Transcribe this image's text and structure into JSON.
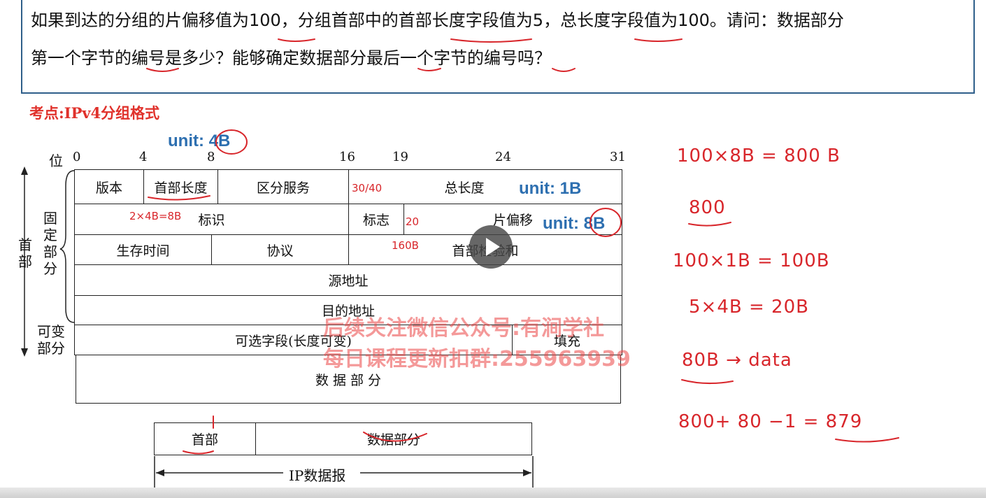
{
  "question": {
    "line1": "如果到达的分组的片偏移值为100，分组首部中的首部长度字段值为5，总长度字段值为100。请问：数据部分",
    "line2": "第一个字节的编号是多少？能够确定数据部分最后一个字节的编号吗？"
  },
  "topic": "考点:IPv4分组格式",
  "units": {
    "u4": "unit: 4B",
    "u1": "unit: 1B",
    "u8": "unit: 8B"
  },
  "bits": {
    "label": "位",
    "b0": "0",
    "b4": "4",
    "b8": "8",
    "b16": "16",
    "b19": "19",
    "b24": "24",
    "b31": "31"
  },
  "side": {
    "header": "首部",
    "fixed": "固定部分",
    "variable": "可变部分"
  },
  "fields": {
    "version": "版本",
    "ihl": "首部长度",
    "tos": "区分服务",
    "total_length": "总长度",
    "identification": "标识",
    "flags": "标志",
    "fragment_offset": "片偏移",
    "ttl": "生存时间",
    "protocol": "协议",
    "checksum": "首部检验和",
    "src": "源地址",
    "dst": "目的地址",
    "options": "可选字段(长度可变)",
    "padding": "填充",
    "data": "数 据 部 分"
  },
  "datagram": {
    "header": "首部",
    "data": "数据部分",
    "label": "IP数据报"
  },
  "annotations": {
    "a1": "30/40",
    "a2": "2×4B=8B",
    "a3": "20",
    "a4": "160B",
    "calc1": "100×8B = 800 B",
    "calc2": "800",
    "calc3": "100×1B = 100B",
    "calc4": "5×4B = 20B",
    "calc5": "80B → data",
    "calc6": "800+ 80 −1 = 879"
  },
  "watermark": {
    "line1": "后续关注微信公众号:有涧学社",
    "line2": "每日课程更新扣群:255963939"
  },
  "player": {
    "play_icon": "play-icon"
  },
  "colors": {
    "accent_blue": "#2d6fb0",
    "annotation_red": "#d8262b",
    "topic_red": "#e0312b",
    "border": "#2f5f8a"
  }
}
